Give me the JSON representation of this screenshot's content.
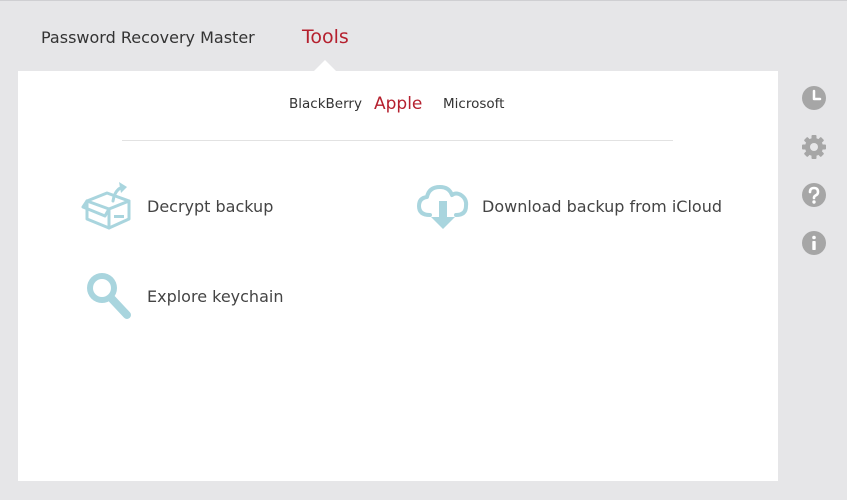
{
  "header": {
    "tabs": [
      {
        "label": "Password Recovery Master"
      },
      {
        "label": "Tools"
      }
    ],
    "active_tab": "Tools"
  },
  "subtabs": {
    "items": [
      {
        "label": "BlackBerry"
      },
      {
        "label": "Apple"
      },
      {
        "label": "Microsoft"
      }
    ],
    "active": "Apple"
  },
  "tools": [
    {
      "label": "Decrypt backup",
      "icon": "box-icon"
    },
    {
      "label": "Download backup from iCloud",
      "icon": "cloud-download-icon"
    },
    {
      "label": "Explore keychain",
      "icon": "magnifier-icon"
    }
  ],
  "sidebar": {
    "icons": [
      "history-icon",
      "settings-icon",
      "help-icon",
      "info-icon"
    ]
  },
  "colors": {
    "accent": "#b5202e",
    "icon_blue": "#a9d5de",
    "side_icon": "#a6a6a6",
    "background": "#e6e6e8",
    "panel": "#ffffff"
  }
}
